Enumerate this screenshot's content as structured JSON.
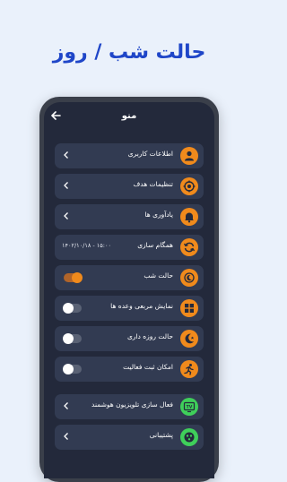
{
  "headline": "حالت شب / روز",
  "menu": {
    "title": "منو",
    "items": [
      {
        "label": "اطلاعات کاربری",
        "icon": "user-icon",
        "control": "chevron"
      },
      {
        "label": "تنظیمات هدف",
        "icon": "target-icon",
        "control": "chevron"
      },
      {
        "label": "یادآوری ها",
        "icon": "bell-icon",
        "control": "chevron"
      },
      {
        "label": "همگام سازی",
        "icon": "sync-icon",
        "control": "text",
        "value": "۱۴۰۲/۱۰/۱۸ - ۱۵:۰۰"
      },
      {
        "label": "حالت شب",
        "icon": "moon-icon",
        "control": "toggle",
        "on": true
      },
      {
        "label": "نمایش مربعی وعده ها",
        "icon": "grid-icon",
        "control": "toggle",
        "on": false
      },
      {
        "label": "حالت روزه داری",
        "icon": "crescent-icon",
        "control": "toggle",
        "on": false
      },
      {
        "label": "امکان ثبت فعالیت",
        "icon": "running-icon",
        "control": "toggle",
        "on": false
      },
      {
        "label": "فعال سازی تلویزیون هوشمند",
        "icon": "tv-icon",
        "control": "chevron",
        "iconText": "TV"
      },
      {
        "label": "پشتیبانی",
        "icon": "support-icon",
        "control": "chevron"
      }
    ]
  },
  "colors": {
    "accent": "#f08a1c",
    "green": "#3fcf5a",
    "background": "#eaf1fb",
    "headline": "#1f46c8"
  }
}
